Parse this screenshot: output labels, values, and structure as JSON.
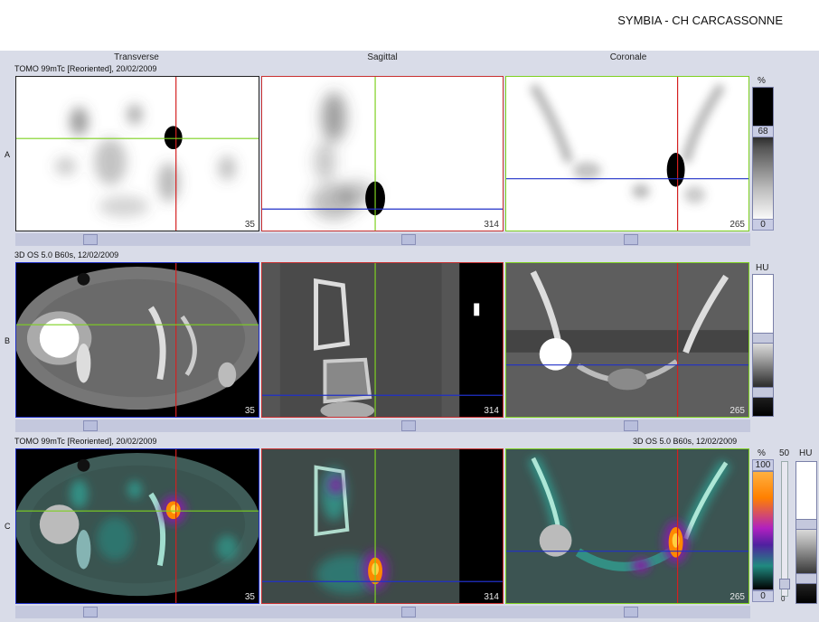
{
  "header": {
    "hospital": "SYMBIA - CH CARCASSONNE"
  },
  "columns": {
    "transverse": "Transverse",
    "sagittal": "Sagittal",
    "coronal": "Coronale"
  },
  "rows": {
    "a": {
      "letter": "A",
      "info": "TOMO 99mTc [Reoriented], 20/02/2009"
    },
    "b": {
      "letter": "B",
      "info": "3D  OS  5.0  B60s, 12/02/2009"
    },
    "c": {
      "letter": "C",
      "info_left": "TOMO 99mTc [Reoriented], 20/02/2009",
      "info_right": "3D  OS  5.0  B60s, 12/02/2009"
    }
  },
  "slices": {
    "transverse": "35",
    "sagittal": "314",
    "coronal": "265"
  },
  "colorbars": {
    "a": {
      "unit": "%",
      "level": "68",
      "min": "0"
    },
    "b": {
      "unit": "HU"
    },
    "c": {
      "unit": "%",
      "max": "100",
      "min": "0",
      "slider_value": "50",
      "slider_min": "0",
      "unit2": "HU"
    }
  },
  "colors": {
    "cross_red": "#d42020",
    "cross_green": "#7ed020",
    "cross_blue": "#2030c8",
    "pet_hot": "#ff8800"
  }
}
